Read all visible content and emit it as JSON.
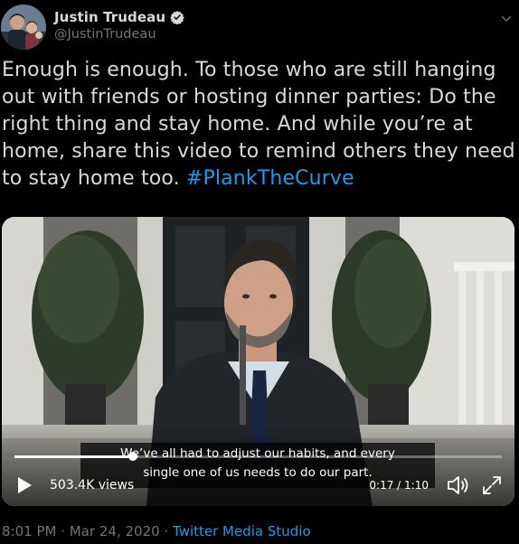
{
  "author": {
    "name": "Justin Trudeau",
    "handle": "@JustinTrudeau",
    "avatar_icon": "avatar-photo",
    "verified_icon": "verified-badge-icon"
  },
  "tweet": {
    "text": "Enough is enough. To those who are still hanging out with friends or hosting dinner parties: Do the right thing and stay home. And while you’re at home, share this video to remind others they need to stay home too.",
    "hashtag": "#PlankTheCurve"
  },
  "video": {
    "subtitle_line1": "We’ve all had to adjust our habits, and every",
    "subtitle_line2": "single one of us needs to do our part.",
    "views": "503.4K views",
    "time": "0:17 / 1:10",
    "progress": 0.243
  },
  "meta": {
    "time": "8:01 PM",
    "separator": "·",
    "date": "Mar 24, 2020",
    "source": "Twitter Media Studio"
  },
  "colors": {
    "background": "#000000",
    "link": "#1d9bf0",
    "secondary_text": "#6e767d",
    "primary_text": "#d9d9d9"
  }
}
